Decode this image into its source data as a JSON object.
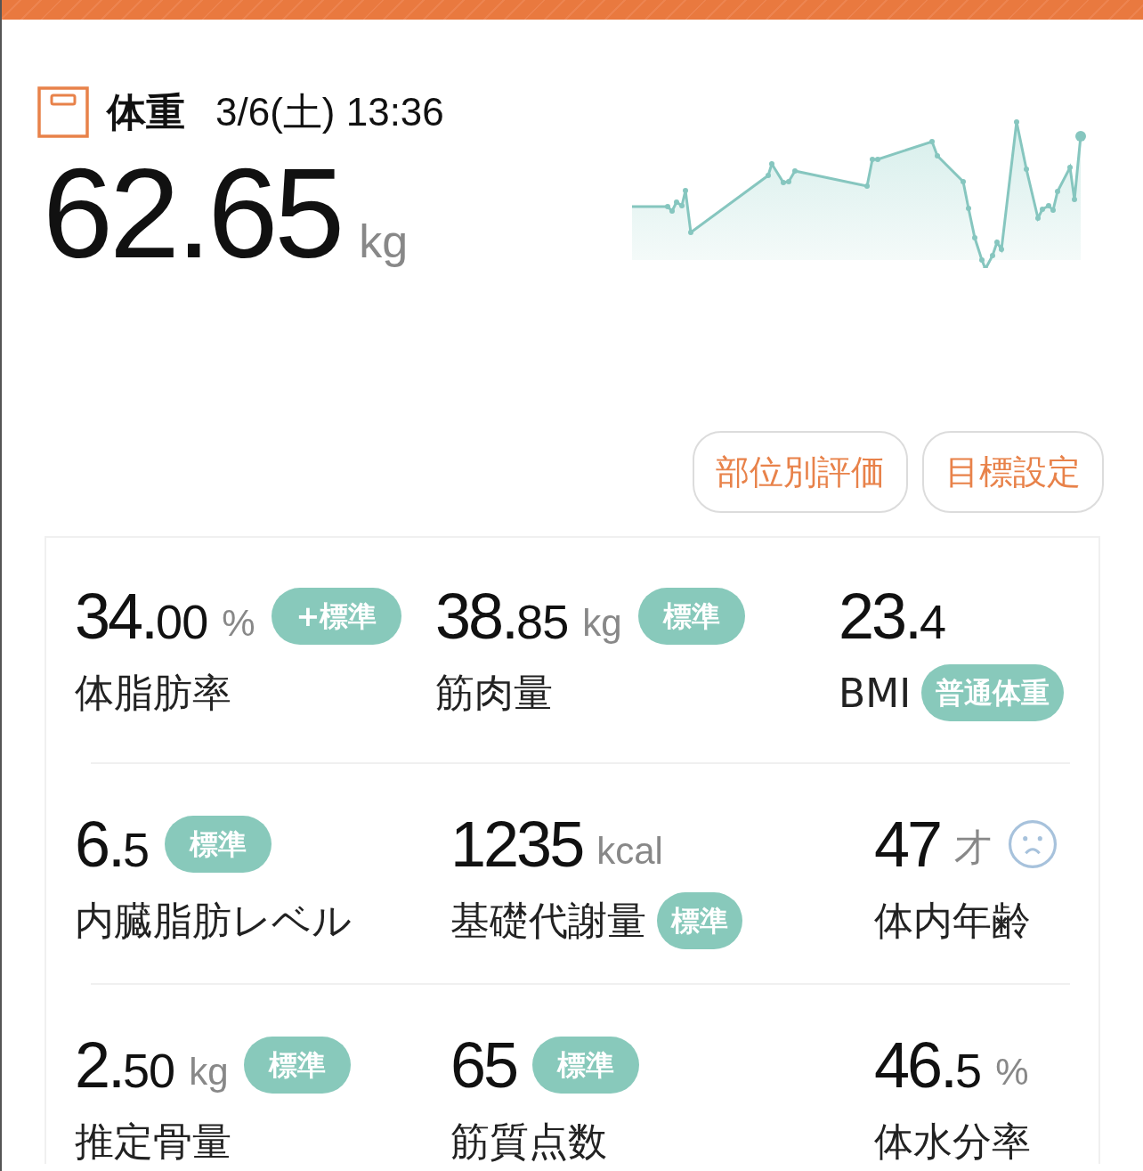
{
  "header": {
    "title": "体重",
    "datetime": "3/6(土) 13:36"
  },
  "weight": {
    "value": "62.65",
    "unit": "kg"
  },
  "buttons": [
    {
      "label": "部位別評価"
    },
    {
      "label": "目標設定"
    }
  ],
  "metrics": [
    {
      "kind": "inline",
      "value": "34.00",
      "unit": "%",
      "badge": "+標準",
      "label": "体脂肪率"
    },
    {
      "kind": "inline",
      "value": "38.85",
      "unit": "kg",
      "badge": "標準",
      "label": "筋肉量"
    },
    {
      "kind": "below",
      "value": "23.4",
      "badge": "普通体重",
      "label": "BMI"
    },
    {
      "kind": "inline",
      "value": "6.5",
      "badge": "標準",
      "label": "内臓脂肪レベル"
    },
    {
      "kind": "below",
      "value": "1235",
      "unit": "kcal",
      "badge": "標準",
      "label": "基礎代謝量"
    },
    {
      "kind": "mood",
      "value": "47",
      "unit": "才",
      "label": "体内年齢"
    },
    {
      "kind": "inline",
      "value": "2.50",
      "unit": "kg",
      "badge": "標準",
      "label": "推定骨量"
    },
    {
      "kind": "inline",
      "value": "65",
      "badge": "標準",
      "label": "筋質点数"
    },
    {
      "kind": "plain",
      "value": "46.5",
      "unit": "%",
      "label": "体水分率"
    }
  ]
}
